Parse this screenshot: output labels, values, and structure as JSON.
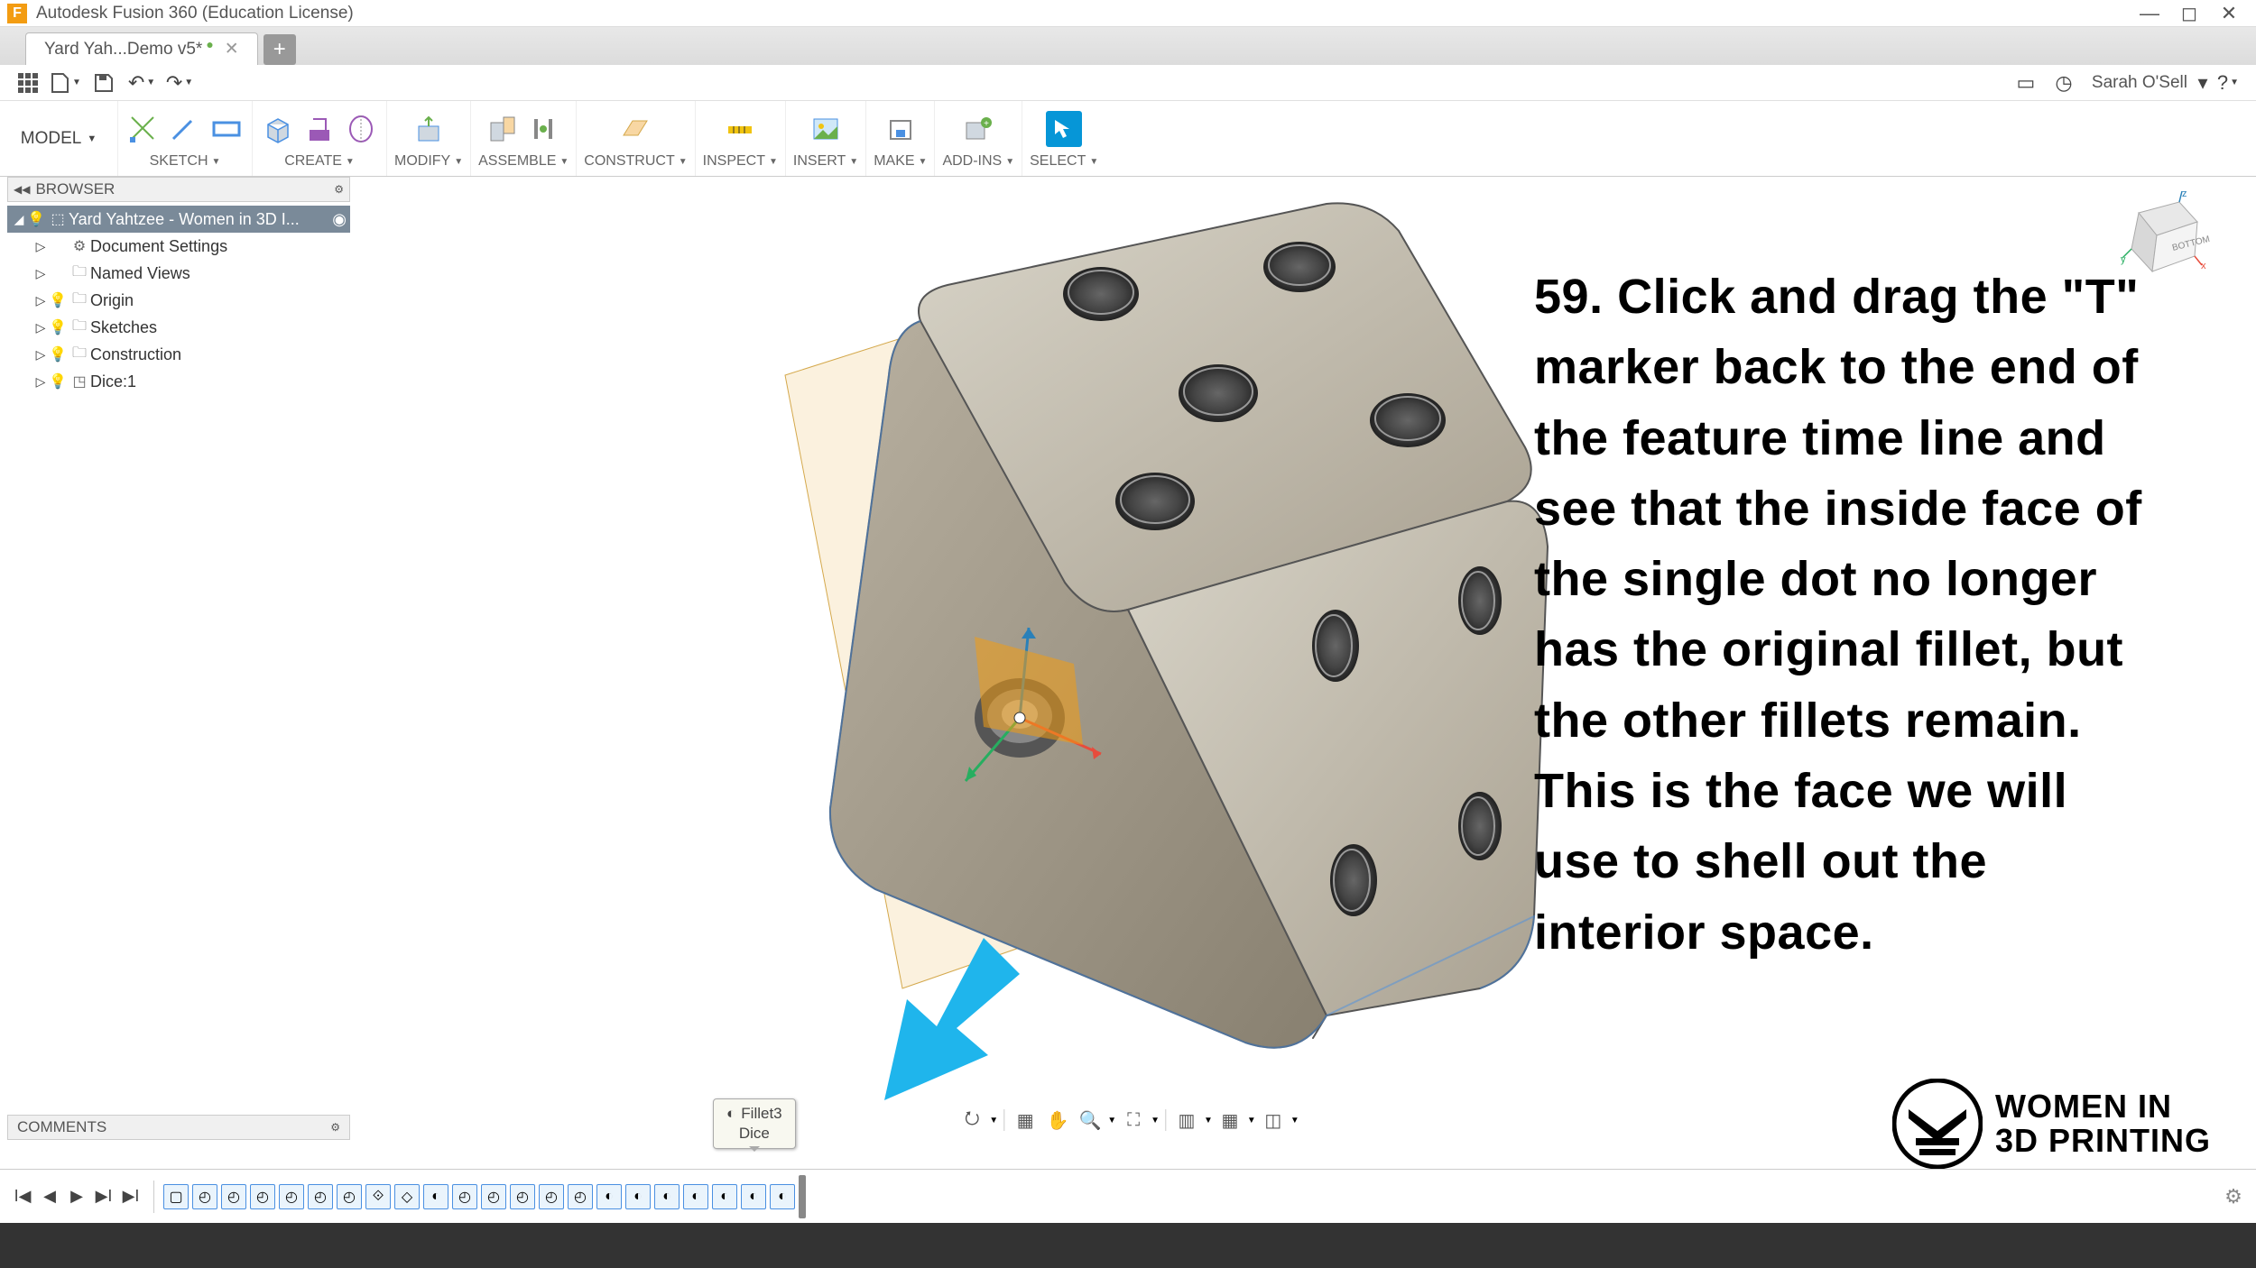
{
  "app_title": "Autodesk Fusion 360 (Education License)",
  "tab": {
    "label": "Yard Yah...Demo v5*",
    "dirty": true
  },
  "quick": {
    "grid_icon": "grid",
    "file_icon": "file",
    "save_icon": "save",
    "undo_icon": "undo",
    "redo_icon": "redo"
  },
  "topright": {
    "username": "Sarah O'Sell"
  },
  "ribbon": {
    "mode": "MODEL",
    "groups": [
      {
        "id": "sketch",
        "label": "SKETCH",
        "icons": [
          "sketch-icon",
          "rect-icon",
          "circle-icon"
        ]
      },
      {
        "id": "create",
        "label": "CREATE",
        "icons": [
          "box-icon",
          "cyl-icon",
          "sphere-icon"
        ]
      },
      {
        "id": "modify",
        "label": "MODIFY",
        "icons": [
          "fillet-icon"
        ]
      },
      {
        "id": "assemble",
        "label": "ASSEMBLE",
        "icons": [
          "joint-icon",
          "joint2-icon"
        ]
      },
      {
        "id": "construct",
        "label": "CONSTRUCT",
        "icons": [
          "plane-icon"
        ]
      },
      {
        "id": "inspect",
        "label": "INSPECT",
        "icons": [
          "measure-icon"
        ]
      },
      {
        "id": "insert",
        "label": "INSERT",
        "icons": [
          "image-icon"
        ]
      },
      {
        "id": "make",
        "label": "MAKE",
        "icons": [
          "print-icon"
        ]
      },
      {
        "id": "addins",
        "label": "ADD-INS",
        "icons": [
          "addin-icon"
        ]
      },
      {
        "id": "select",
        "label": "SELECT",
        "icons": [
          "select-icon"
        ]
      }
    ]
  },
  "browser": {
    "title": "BROWSER",
    "root": "Yard Yahtzee - Women in 3D I...",
    "items": [
      {
        "label": "Document Settings",
        "icon": "gear-icon",
        "bulb": false
      },
      {
        "label": "Named Views",
        "icon": "folder-icon",
        "bulb": false
      },
      {
        "label": "Origin",
        "icon": "folder-icon",
        "bulb": true
      },
      {
        "label": "Sketches",
        "icon": "folder-icon",
        "bulb": true
      },
      {
        "label": "Construction",
        "icon": "folder-icon",
        "bulb": true
      },
      {
        "label": "Dice:1",
        "icon": "body-icon",
        "bulb": true
      }
    ]
  },
  "comments": "COMMENTS",
  "tooltip": {
    "line1": "Fillet3",
    "line2": "Dice"
  },
  "timeline": {
    "feature_count": 22,
    "marker_index": 22
  },
  "viewcube": {
    "face": "BOTTOM",
    "axes": [
      "x",
      "y",
      "z"
    ]
  },
  "instruction": "59. Click and drag the \"T\" marker back to the end of the feature time line and see that the inside face of the single dot no longer has the original fillet, but the other fillets remain. This is the face we will use to shell out the interior space.",
  "logo": {
    "line1": "WOMEN IN",
    "line2": "3D PRINTING"
  }
}
